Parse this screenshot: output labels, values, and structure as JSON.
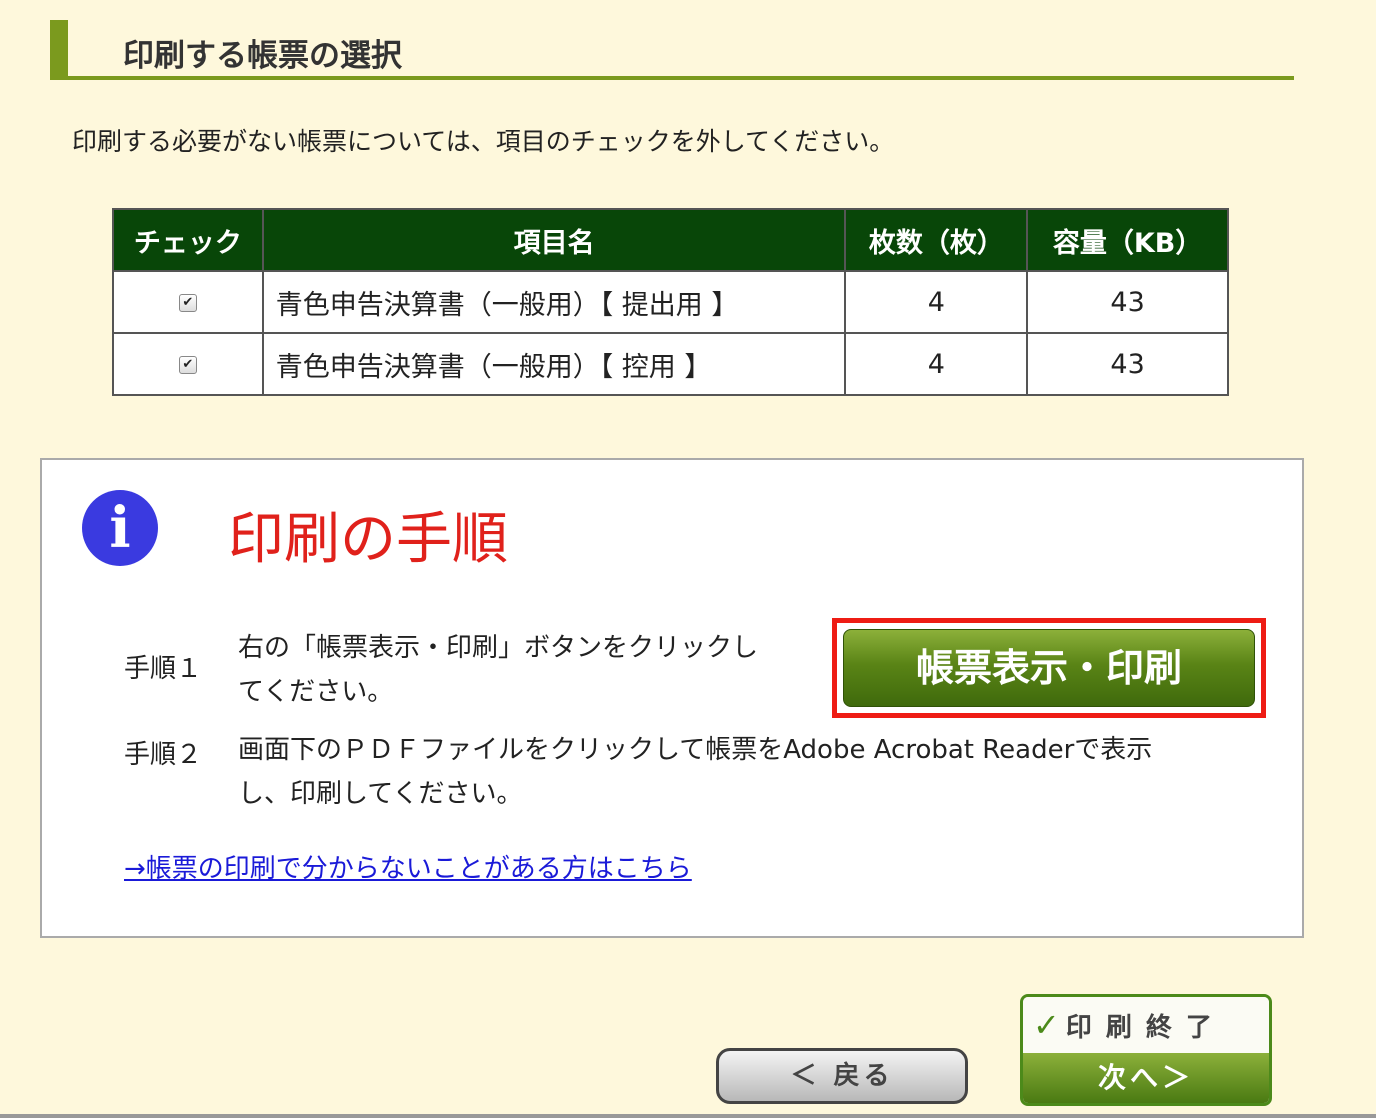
{
  "section_title": "印刷する帳票の選択",
  "instruction": "印刷する必要がない帳票については、項目のチェックを外してください。",
  "table": {
    "headers": [
      "チェック",
      "項目名",
      "枚数（枚）",
      "容量（KB）"
    ],
    "rows": [
      {
        "checked": true,
        "name": "青色申告決算書（一般用）【 提出用 】",
        "pages": "4",
        "size": "43"
      },
      {
        "checked": true,
        "name": "青色申告決算書（一般用）【 控用 】",
        "pages": "4",
        "size": "43"
      }
    ]
  },
  "info": {
    "icon": "info-icon",
    "icon_glyph": "i",
    "title": "印刷の手順",
    "step1_label": "手順１",
    "step1_text_line1": "右の「帳票表示・印刷」ボタンをクリックし",
    "step1_text_line2": "てください。",
    "print_button": "帳票表示・印刷",
    "step2_label": "手順２",
    "step2_text_line1": "画面下のＰＤＦファイルをクリックして帳票をAdobe Acrobat Readerで表示",
    "step2_text_line2": "し、印刷してください。",
    "help_link": "→帳票の印刷で分からないことがある方はこちら"
  },
  "nav": {
    "back_button": "＜ 戻る",
    "finish_top": "印刷終了",
    "finish_check": "✓",
    "finish_bottom": "次へ＞"
  },
  "colors": {
    "background": "#fef8dc",
    "header_green": "#084608",
    "accent_green": "#7b9a1e",
    "title_red": "#e0211b",
    "highlight_red": "#ee1c14",
    "info_blue": "#3a3ae0",
    "link_blue": "#1a1ad8"
  }
}
